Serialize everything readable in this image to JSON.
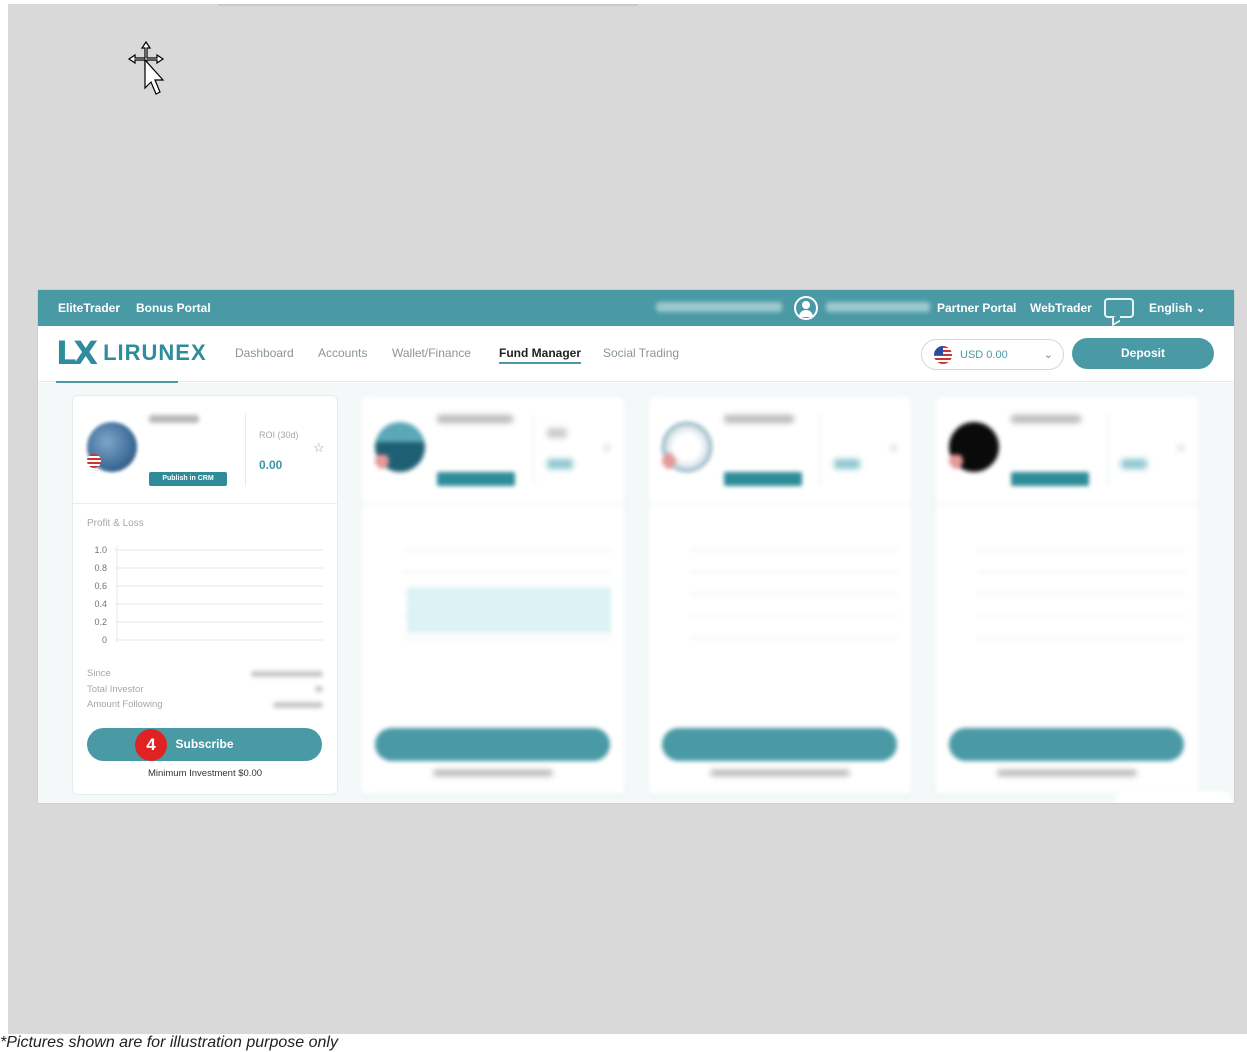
{
  "topbar": {
    "left_links": [
      "EliteTrader",
      "Bonus Portal"
    ],
    "right_links": [
      "Partner Portal",
      "WebTrader"
    ],
    "language": "English ⌄"
  },
  "navbar": {
    "logo_mark": "LX",
    "logo_text": "LIRUNEX",
    "items": [
      "Dashboard",
      "Accounts",
      "Wallet/Finance",
      "Fund Manager",
      "Social Trading"
    ],
    "active_item": "Fund Manager",
    "currency": "USD 0.00",
    "deposit_label": "Deposit"
  },
  "card1": {
    "badge": "Publish in CRM",
    "roi_label": "ROI (30d)",
    "roi_value": "0.00",
    "pl_label": "Profit & Loss",
    "y_ticks": [
      "1.0",
      "0.8",
      "0.6",
      "0.4",
      "0.2",
      "0"
    ],
    "stats": [
      "Since",
      "Total Investor",
      "Amount Following"
    ],
    "subscribe_label": "Subscribe",
    "min_investment": "Minimum Investment $0.00"
  },
  "step_number": "4",
  "colors": {
    "brand": "#4a9aa6",
    "badge_red": "#e02222"
  },
  "footnote": "*Pictures shown are for illustration purpose only"
}
